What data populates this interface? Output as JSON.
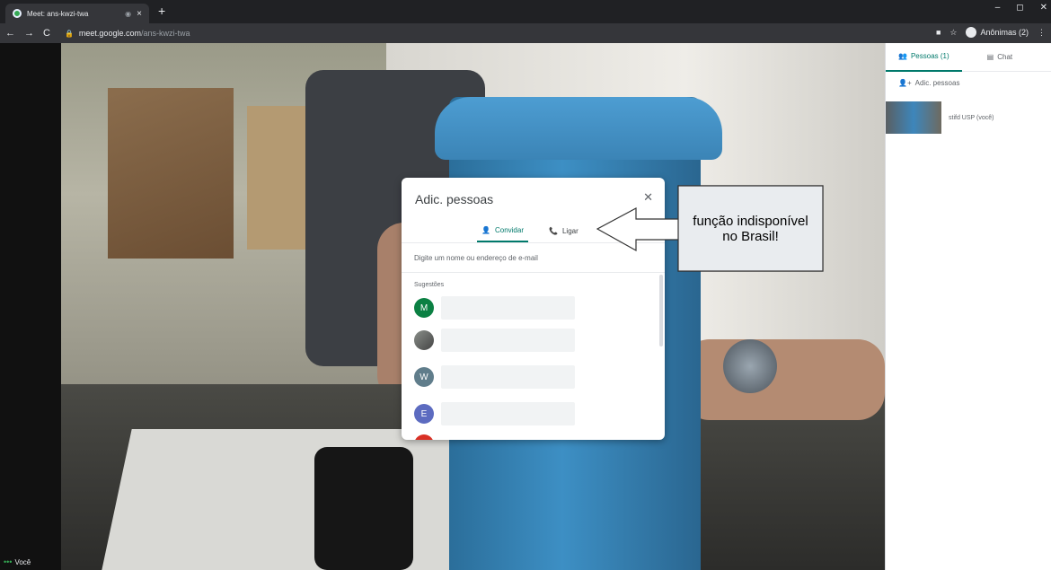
{
  "browser": {
    "tab_title": "Meet: ans-kwzi-twa",
    "tab_close": "×",
    "recording_icon": "recording-dot-icon",
    "new_tab": "+",
    "window_controls": [
      "–",
      "◻",
      "✕"
    ],
    "url_host": "meet.google.com",
    "url_path": "/ans-kwzi-twa",
    "profile_label": "Anônimas (2)"
  },
  "video": {
    "self_label": "Você"
  },
  "panel": {
    "tabs": [
      {
        "label": "Pessoas (1)",
        "icon": "people-icon",
        "active": true
      },
      {
        "label": "Chat",
        "icon": "chat-icon",
        "active": false
      }
    ],
    "add_people": "Adic. pessoas",
    "participants": [
      {
        "name": "stifd USP (você)"
      }
    ]
  },
  "dialog": {
    "title": "Adic. pessoas",
    "close_icon": "close-icon",
    "tabs": [
      {
        "label": "Convidar",
        "icon": "person-add-icon",
        "active": true
      },
      {
        "label": "Ligar",
        "icon": "phone-icon",
        "active": false
      }
    ],
    "input_placeholder": "Digite um nome ou endereço de e-mail",
    "suggestions_label": "Sugestões",
    "suggestions": [
      {
        "initial": "M",
        "color": "#0b8043"
      },
      {
        "initial": "",
        "color": "#6d6d6d"
      },
      {
        "initial": "W",
        "color": "#607d8b"
      },
      {
        "initial": "E",
        "color": "#5c6bc0"
      },
      {
        "initial": "",
        "color": "#d93025"
      }
    ]
  },
  "annotation": {
    "text": "função indisponível no Brasil!"
  },
  "colors": {
    "accent": "#00796b",
    "chrome_dark": "#202124",
    "chrome_bar": "#35363a"
  }
}
